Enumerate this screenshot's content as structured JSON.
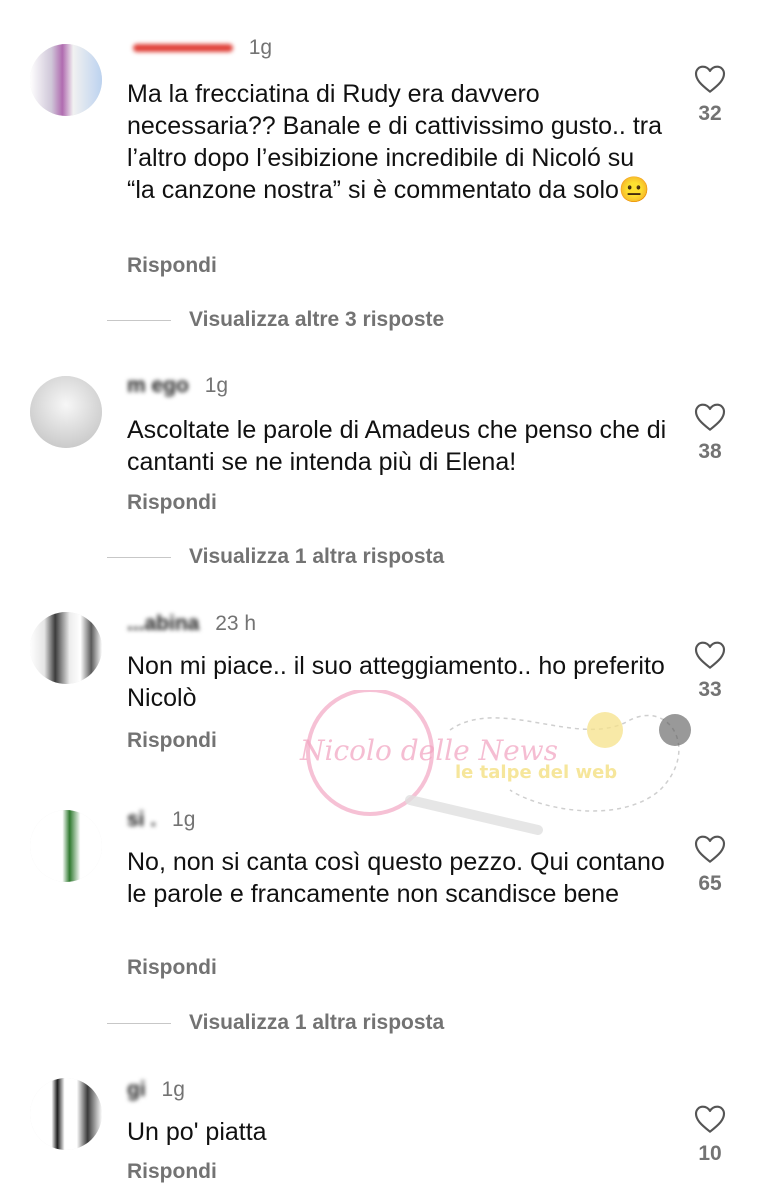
{
  "comments": [
    {
      "user": "",
      "time": "1g",
      "text": "Ma la frecciatina di Rudy era davvero necessaria?? Banale e di cattivissimo gusto.. tra l’altro dopo l’esibizione incredibile di Nicoló su “la canzone nostra” si è commentato da solo😐",
      "reply": "Rispondi",
      "likes": "32",
      "more": "Visualizza altre 3 risposte"
    },
    {
      "user": "m          ego",
      "time": "1g",
      "text": "Ascoltate le parole di Amadeus che penso che di cantanti se ne intenda più  di Elena!",
      "reply": "Rispondi",
      "likes": "38",
      "more": "Visualizza 1 altra risposta"
    },
    {
      "user": "        ...abina",
      "time": "23 h",
      "text": "Non mi piace.. il suo atteggiamento.. ho preferito Nicolò",
      "reply": "Rispondi",
      "likes": "33",
      "more": ""
    },
    {
      "user": "si          .",
      "time": "1g",
      "text": "No, non si canta così questo pezzo.  Qui contano le parole e francamente non scandisce bene",
      "reply": "Rispondi",
      "likes": "65",
      "more": "Visualizza 1 altra risposta"
    },
    {
      "user": "gi       ",
      "time": "1g",
      "text": "Un po' piatta",
      "reply": "Rispondi",
      "likes": "10",
      "more": ""
    }
  ],
  "watermark": {
    "brand_left": "Nicolo delle News",
    "brand_right": "le talpe del web"
  },
  "icons": {
    "like": "heart-outline-icon"
  },
  "colors": {
    "secondary_text": "#737373",
    "primary_text": "#111111",
    "watermark_pink": "#f2a7c3",
    "watermark_yellow": "#f5e28a"
  }
}
